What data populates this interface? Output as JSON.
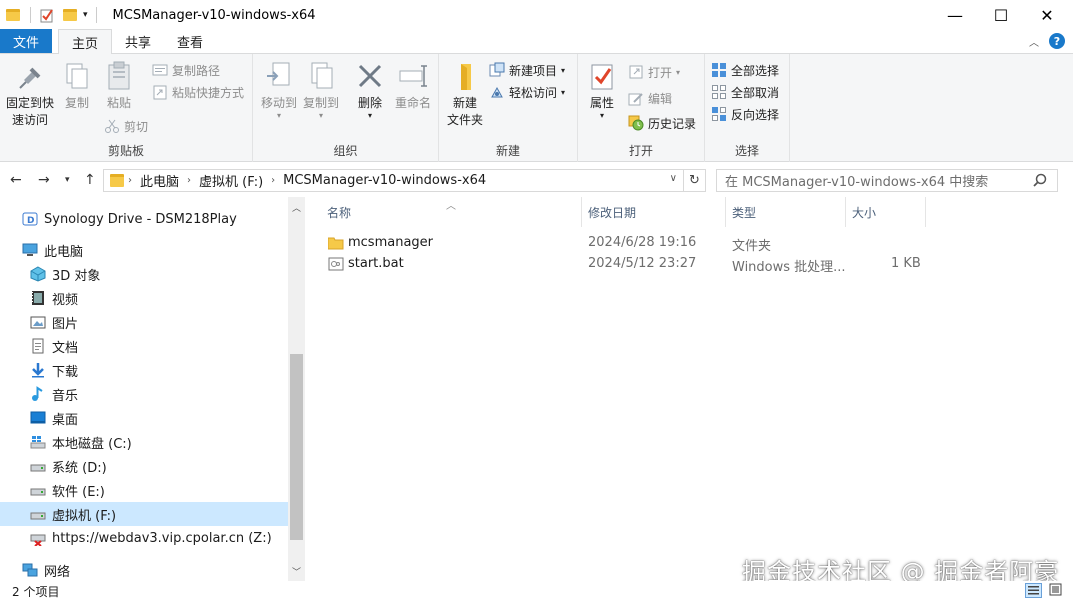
{
  "window": {
    "title": "MCSManager-v10-windows-x64",
    "controls": {
      "minimize": "—",
      "maximize": "☐",
      "close": "✕"
    }
  },
  "tabs": [
    {
      "label": "文件"
    },
    {
      "label": "主页"
    },
    {
      "label": "共享"
    },
    {
      "label": "查看"
    }
  ],
  "ribbon": {
    "clipboard": {
      "label": "剪贴板",
      "pin_line1": "固定到快",
      "pin_line2": "速访问",
      "copy": "复制",
      "paste": "粘贴",
      "copy_path": "复制路径",
      "paste_shortcut": "粘贴快捷方式",
      "cut": "剪切"
    },
    "organize": {
      "label": "组织",
      "move_to": "移动到",
      "copy_to": "复制到",
      "delete": "删除",
      "rename": "重命名"
    },
    "new": {
      "label": "新建",
      "new_folder_line1": "新建",
      "new_folder_line2": "文件夹",
      "new_item": "新建项目",
      "easy_access": "轻松访问"
    },
    "open": {
      "label": "打开",
      "properties": "属性",
      "open": "打开",
      "edit": "编辑",
      "history": "历史记录"
    },
    "select": {
      "label": "选择",
      "select_all": "全部选择",
      "select_none": "全部取消",
      "invert": "反向选择"
    }
  },
  "address": {
    "crumbs": [
      "此电脑",
      "虚拟机 (F:)",
      "MCSManager-v10-windows-x64"
    ],
    "search_placeholder": "在 MCSManager-v10-windows-x64 中搜索"
  },
  "nav": {
    "items": [
      {
        "label": "Synology Drive - DSM218Play",
        "icon": "synology-drive-icon"
      },
      {
        "label": "此电脑",
        "icon": "this-pc-icon"
      },
      {
        "label": "3D 对象",
        "icon": "3d-objects-icon"
      },
      {
        "label": "视频",
        "icon": "video-icon"
      },
      {
        "label": "图片",
        "icon": "pictures-icon"
      },
      {
        "label": "文档",
        "icon": "documents-icon"
      },
      {
        "label": "下载",
        "icon": "downloads-icon"
      },
      {
        "label": "音乐",
        "icon": "music-icon"
      },
      {
        "label": "桌面",
        "icon": "desktop-icon"
      },
      {
        "label": "本地磁盘 (C:)",
        "icon": "windows-drive-icon"
      },
      {
        "label": "系统 (D:)",
        "icon": "drive-icon"
      },
      {
        "label": "软件 (E:)",
        "icon": "drive-icon"
      },
      {
        "label": "虚拟机 (F:)",
        "icon": "drive-icon",
        "selected": true
      },
      {
        "label": "https://webdav3.vip.cpolar.cn (Z:)",
        "icon": "disconnected-network-drive-icon"
      },
      {
        "label": "网络",
        "icon": "network-icon"
      }
    ]
  },
  "columns": {
    "name": "名称",
    "modified": "修改日期",
    "type": "类型",
    "size": "大小"
  },
  "files": [
    {
      "name": "mcsmanager",
      "modified": "2024/6/28 19:16",
      "type": "文件夹",
      "size": "",
      "icon": "folder-icon"
    },
    {
      "name": "start.bat",
      "modified": "2024/5/12 23:27",
      "type": "Windows 批处理...",
      "size": "1 KB",
      "icon": "batch-file-icon"
    }
  ],
  "status": {
    "count": "2 个项目"
  },
  "watermark": "掘金技术社区 @ 掘金者阿豪",
  "colors": {
    "accent": "#1979ca",
    "selection": "#cce8ff",
    "folder": "#f6c948"
  }
}
